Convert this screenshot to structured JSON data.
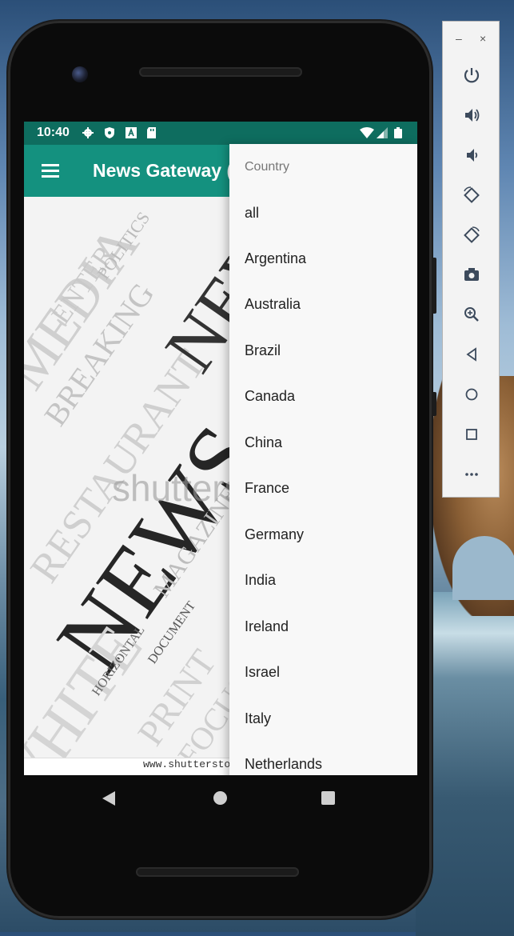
{
  "status_bar": {
    "time": "10:40",
    "icons": [
      "gear-icon",
      "shield-icon",
      "font-icon",
      "sd-card-icon"
    ],
    "right_icons": [
      "wifi-icon",
      "signal-icon",
      "battery-icon"
    ]
  },
  "app_bar": {
    "title": "News Gateway (",
    "menu_icon": "hamburger-menu-icon"
  },
  "image": {
    "watermark_text": "shutterst",
    "footer_url": "www.shutterstock.co"
  },
  "dropdown": {
    "header": "Country",
    "items": [
      "all",
      "Argentina",
      "Australia",
      "Brazil",
      "Canada",
      "China",
      "France",
      "Germany",
      "India",
      "Ireland",
      "Israel",
      "Italy",
      "Netherlands"
    ]
  },
  "nav_bar": {
    "icons": [
      "back-icon",
      "home-icon",
      "recents-icon"
    ]
  },
  "emulator_panel": {
    "window_controls": [
      "–",
      "×"
    ],
    "tools": [
      "power-icon",
      "volume-up-icon",
      "volume-down-icon",
      "rotate-left-icon",
      "rotate-right-icon",
      "camera-icon",
      "zoom-icon",
      "back-icon",
      "home-icon",
      "overview-icon",
      "more-icon"
    ]
  },
  "colors": {
    "status_bar": "#0e6d5f",
    "app_bar": "#14917f",
    "dropdown_bg": "#f8f8f8"
  }
}
